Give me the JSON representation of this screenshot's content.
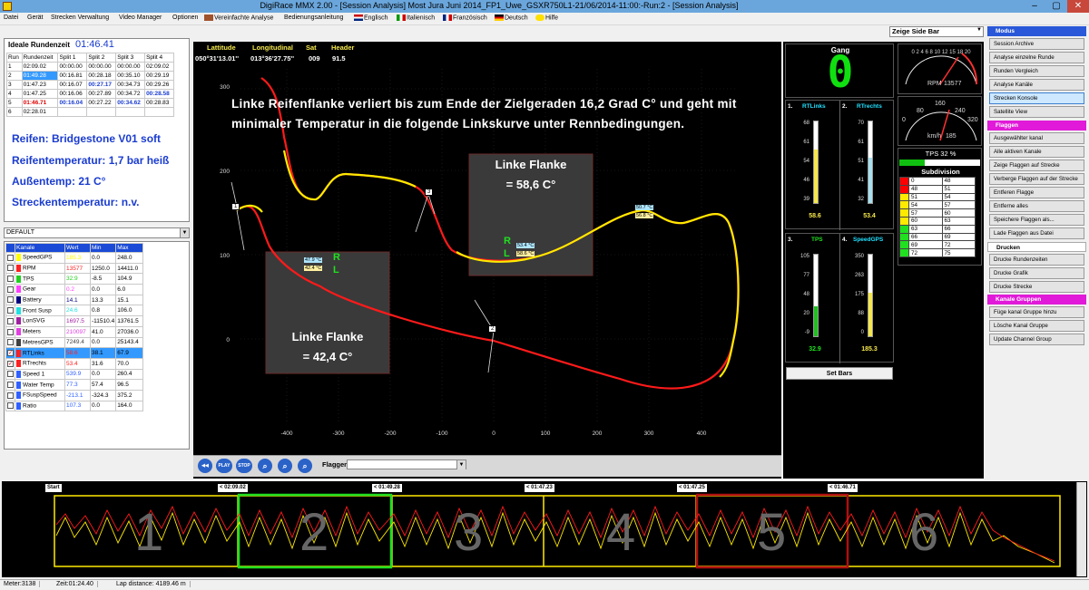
{
  "window": {
    "title": "DigiRace MMX 2.00 - [Session Analysis]  Most Jura Juni 2014_FP1_Uwe_GSXR750L1-21/06/2014-11:00:-Run:2 - [Session Analysis]"
  },
  "menu": {
    "datei": "Datei",
    "geraet": "Gerät",
    "strecken": "Strecken Verwaltung",
    "video": "Video Manager",
    "optionen": "Optionen",
    "vereinfacht": "Vereinfachte Analyse",
    "anleitung": "Bedienungsanleitung",
    "englisch": "Englisch",
    "italienisch": "Italienisch",
    "franzoesisch": "Französisch",
    "deutsch": "Deutsch",
    "hilfe": "Hilfe"
  },
  "ideal": {
    "label": "Ideale Rundenzeit",
    "value": "01:46.41"
  },
  "laps": {
    "headers": [
      "Run",
      "Rundenzeit",
      "Split 1",
      "Split 2",
      "Split 3",
      "Split 4"
    ],
    "rows": [
      [
        "1",
        "02:09.02",
        "00:00.00",
        "00:00.00",
        "00:00.00",
        "02:09.02"
      ],
      [
        "2",
        "01:49.28",
        "00:16.81",
        "00:28.18",
        "00:35.10",
        "00:29.19"
      ],
      [
        "3",
        "01:47.23",
        "00:16.07",
        "00:27.17",
        "00:34.73",
        "00:29.26"
      ],
      [
        "4",
        "01:47.25",
        "00:16.06",
        "00:27.89",
        "00:34.72",
        "00:28.58"
      ],
      [
        "5",
        "01:46.71",
        "00:16.04",
        "00:27.22",
        "00:34.62",
        "00:28.83"
      ],
      [
        "6",
        "02:28.01",
        "",
        "",
        "",
        ""
      ]
    ]
  },
  "info": {
    "reifen": "Reifen: Bridgestone V01 soft",
    "druck": "Reifentemperatur: 1,7 bar heiß",
    "aussen": "Außentemp: 21 C°",
    "strecke": "Streckentemperatur: n.v."
  },
  "preset": {
    "value": "DEFAULT"
  },
  "channels": {
    "headers": [
      "Kanale",
      "Wert",
      "Min",
      "Max"
    ],
    "rows": [
      {
        "name": "SpeedGPS",
        "wert": "185.3",
        "min": "0.0",
        "max": "248.0",
        "color": "#ffff00",
        "checked": false
      },
      {
        "name": "RPM",
        "wert": "13577",
        "min": "1250.0",
        "max": "14411.0",
        "color": "#ff2020",
        "checked": false
      },
      {
        "name": "TPS",
        "wert": "32.9",
        "min": "-8.5",
        "max": "104.9",
        "color": "#20d020",
        "checked": false
      },
      {
        "name": "Gear",
        "wert": "0.2",
        "min": "0.0",
        "max": "6.0",
        "color": "#ff40ff",
        "checked": false
      },
      {
        "name": "Battery",
        "wert": "14.1",
        "min": "13.3",
        "max": "15.1",
        "color": "#000080",
        "checked": false
      },
      {
        "name": "Front Susp",
        "wert": "24.6",
        "min": "0.8",
        "max": "106.0",
        "color": "#20e0e0",
        "checked": false
      },
      {
        "name": "LonSVG",
        "wert": "1697.5",
        "min": "-11510.4",
        "max": "13761.5",
        "color": "#a020a0",
        "checked": false
      },
      {
        "name": "Meters",
        "wert": "210097",
        "min": "41.0",
        "max": "27036.0",
        "color": "#e040e0",
        "checked": false
      },
      {
        "name": "MetresGPS",
        "wert": "7249.4",
        "min": "0.0",
        "max": "25143.4",
        "color": "#404040",
        "checked": false
      },
      {
        "name": "RTLinks",
        "wert": "58.6",
        "min": "38.1",
        "max": "67.9",
        "color": "#ff2020",
        "checked": true
      },
      {
        "name": "RTrechts",
        "wert": "53.4",
        "min": "31.6",
        "max": "70.0",
        "color": "#ff2020",
        "checked": true
      },
      {
        "name": "Speed 1",
        "wert": "539.9",
        "min": "0.0",
        "max": "260.4",
        "color": "#3060ff",
        "checked": false
      },
      {
        "name": "Water Temp",
        "wert": "77.3",
        "min": "57.4",
        "max": "96.5",
        "color": "#3060ff",
        "checked": false
      },
      {
        "name": "FSuspSpeed",
        "wert": "-213.1",
        "min": "-324.3",
        "max": "375.2",
        "color": "#3060ff",
        "checked": false
      },
      {
        "name": "Ratio",
        "wert": "107.3",
        "min": "0.0",
        "max": "164.0",
        "color": "#3060ff",
        "checked": false
      }
    ]
  },
  "gps": {
    "headers": [
      "Lattitude",
      "Longitudinal",
      "Sat",
      "Header"
    ],
    "values": [
      "050°31'13.01''",
      "013°36'27.75''",
      "009",
      "91.5"
    ]
  },
  "map": {
    "note": "Linke Reifenflanke verliert bis zum Ende der Zielgeraden 16,2 Grad C° und geht mit minimaler Temperatur in die folgende Linkskurve unter Rennbedingungen.",
    "flank1": {
      "line1": "Linke Flanke",
      "line2": "= 42,4 C°"
    },
    "flank2": {
      "line1": "Linke Flanke",
      "line2": "= 58,6 C°"
    },
    "tagA": {
      "t1": "47.9 °C",
      "t2": "42.4 °C"
    },
    "tagB": {
      "t1": "53.4 °C",
      "t2": "58.6 °C"
    },
    "tagC": {
      "t1": "50.7 °C",
      "t2": "56.8 °C"
    },
    "rl": {
      "r": "R",
      "l": "L"
    },
    "markers": {
      "m1": "1",
      "m3": "3",
      "m2": "2"
    },
    "xticks": [
      "-400",
      "-300",
      "-200",
      "-100",
      "0",
      "100",
      "200",
      "300",
      "400"
    ],
    "yticks": [
      "300",
      "200",
      "100",
      "0"
    ]
  },
  "toolbar": {
    "play": "PLAY",
    "stop": "STOP",
    "flaggen": "Flaggen"
  },
  "gang": {
    "label": "Gang",
    "value": "0"
  },
  "rpm": {
    "label": "RPM",
    "value": "13577",
    "scale": "0 2 4 6 8 10 12 15 18 20"
  },
  "speed": {
    "label": "km/h",
    "value": "185",
    "scale": [
      "80",
      "160",
      "240",
      "0",
      "320"
    ]
  },
  "tps": {
    "label": "TPS 32 %"
  },
  "subdivision": {
    "label": "Subdivision",
    "rows": [
      [
        "0",
        "48"
      ],
      [
        "48",
        "51"
      ],
      [
        "51",
        "54"
      ],
      [
        "54",
        "57"
      ],
      [
        "57",
        "60"
      ],
      [
        "60",
        "63"
      ],
      [
        "63",
        "66"
      ],
      [
        "66",
        "69"
      ],
      [
        "69",
        "72"
      ],
      [
        "72",
        "75"
      ]
    ]
  },
  "gauges": {
    "g1": {
      "num": "1.",
      "name": "RTLinks",
      "ticks": [
        "68",
        "61",
        "54",
        "46",
        "39"
      ],
      "value": "58.6"
    },
    "g2": {
      "num": "2.",
      "name": "RTrechts",
      "ticks": [
        "70",
        "61",
        "51",
        "41",
        "32"
      ],
      "value": "53.4"
    },
    "g3": {
      "num": "3.",
      "name": "TPS",
      "ticks": [
        "105",
        "77",
        "48",
        "20",
        "-9"
      ],
      "value": "32.9"
    },
    "g4": {
      "num": "4.",
      "name": "SpeedGPS",
      "ticks": [
        "350",
        "263",
        "175",
        "88",
        "0"
      ],
      "value": "185.3"
    }
  },
  "setbars": "Set Bars",
  "zeige": "Zeige Side Bar",
  "sidebar": {
    "modus": {
      "title": "Modus",
      "items": [
        "Session Archive",
        "Analyse einzelne Runde",
        "Runden Vergleich",
        "Analyse Kanäle",
        "Strecken Konsole",
        "Satellite View"
      ]
    },
    "flaggen": {
      "title": "Flaggen",
      "items": [
        "Ausgewählter kanal",
        "Alle aktiven Kanale",
        "Zeige Flaggen auf Strecke",
        "Verberge Flaggen auf der Strecke",
        "Entferen Flagge",
        "Entferne alles",
        "Speichere Flaggen als...",
        "Lade Flaggen aus Datei"
      ]
    },
    "drucken": {
      "title": "Drucken",
      "items": [
        "Drucke Rundenzeiten",
        "Drucke Grafik",
        "Drucke Strecke"
      ]
    },
    "gruppen": {
      "title": "Kanale Gruppen",
      "items": [
        "Füge kanal Gruppe hinzu",
        "Lösche Kanal Gruppe",
        "Update Channel Group"
      ]
    }
  },
  "bottom": {
    "start": "Start",
    "laptimes": [
      "< 02:09.02",
      "< 01:49.28",
      "< 01:47.23",
      "< 01:47.25",
      "< 01:46.71"
    ],
    "lapnums": [
      "1",
      "2",
      "3",
      "4",
      "5",
      "6"
    ]
  },
  "status": {
    "meter": "Meter:3138",
    "zeit": "Zeit:01:24.40",
    "lapdist": "Lap distance: 4189.46 m"
  }
}
